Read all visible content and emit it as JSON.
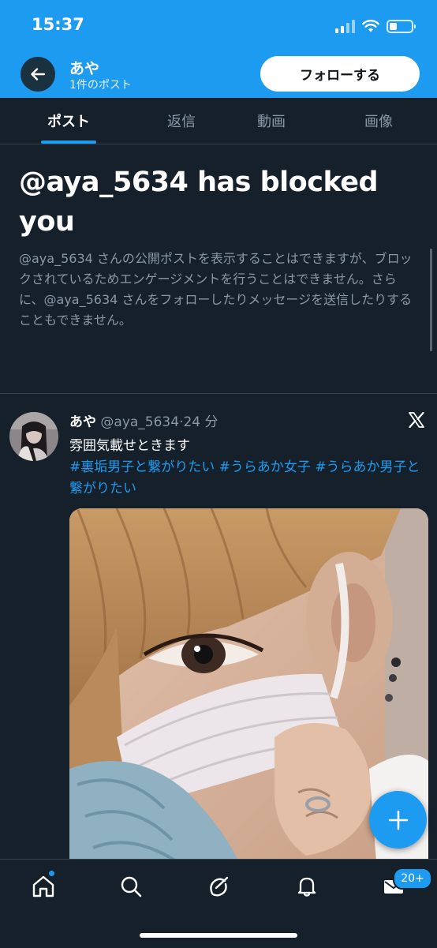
{
  "status_bar": {
    "time": "15:37",
    "battery_level": 0.25
  },
  "header": {
    "display_name": "あや",
    "post_count": "1件のポスト",
    "follow_label": "フォローする",
    "background_color": "#1d9bf0"
  },
  "tabs": [
    {
      "label": "ポスト",
      "active": true
    },
    {
      "label": "返信",
      "active": false
    },
    {
      "label": "動画",
      "active": false
    },
    {
      "label": "画像",
      "active": false
    }
  ],
  "block_notice": {
    "title": "@aya_5634 has blocked you",
    "description": "@aya_5634 さんの公開ポストを表示することはできますが、ブロックされているためエンゲージメントを行うことはできません。さらに、@aya_5634 さんをフォローしたりメッセージを送信したりすることもできません。"
  },
  "post": {
    "author_name": "あや",
    "meta": "@aya_5634·24 分",
    "text": "雰囲気載せときます",
    "hashtags": [
      "#裏垢男子と繋がりたい",
      "#うらあか女子",
      "#うらあか男子と繋がりたい"
    ],
    "source_icon": "x-logo-icon"
  },
  "fab": {
    "icon": "plus-icon"
  },
  "bottom_nav": {
    "items": [
      "home-icon",
      "search-icon",
      "grok-icon",
      "notifications-bell-icon",
      "messages-envelope-icon"
    ],
    "messages_badge": "20+"
  },
  "colors": {
    "background": "#15202b",
    "accent": "#1d9bf0",
    "secondary_text": "#8b98a5",
    "divider": "#38444d"
  }
}
